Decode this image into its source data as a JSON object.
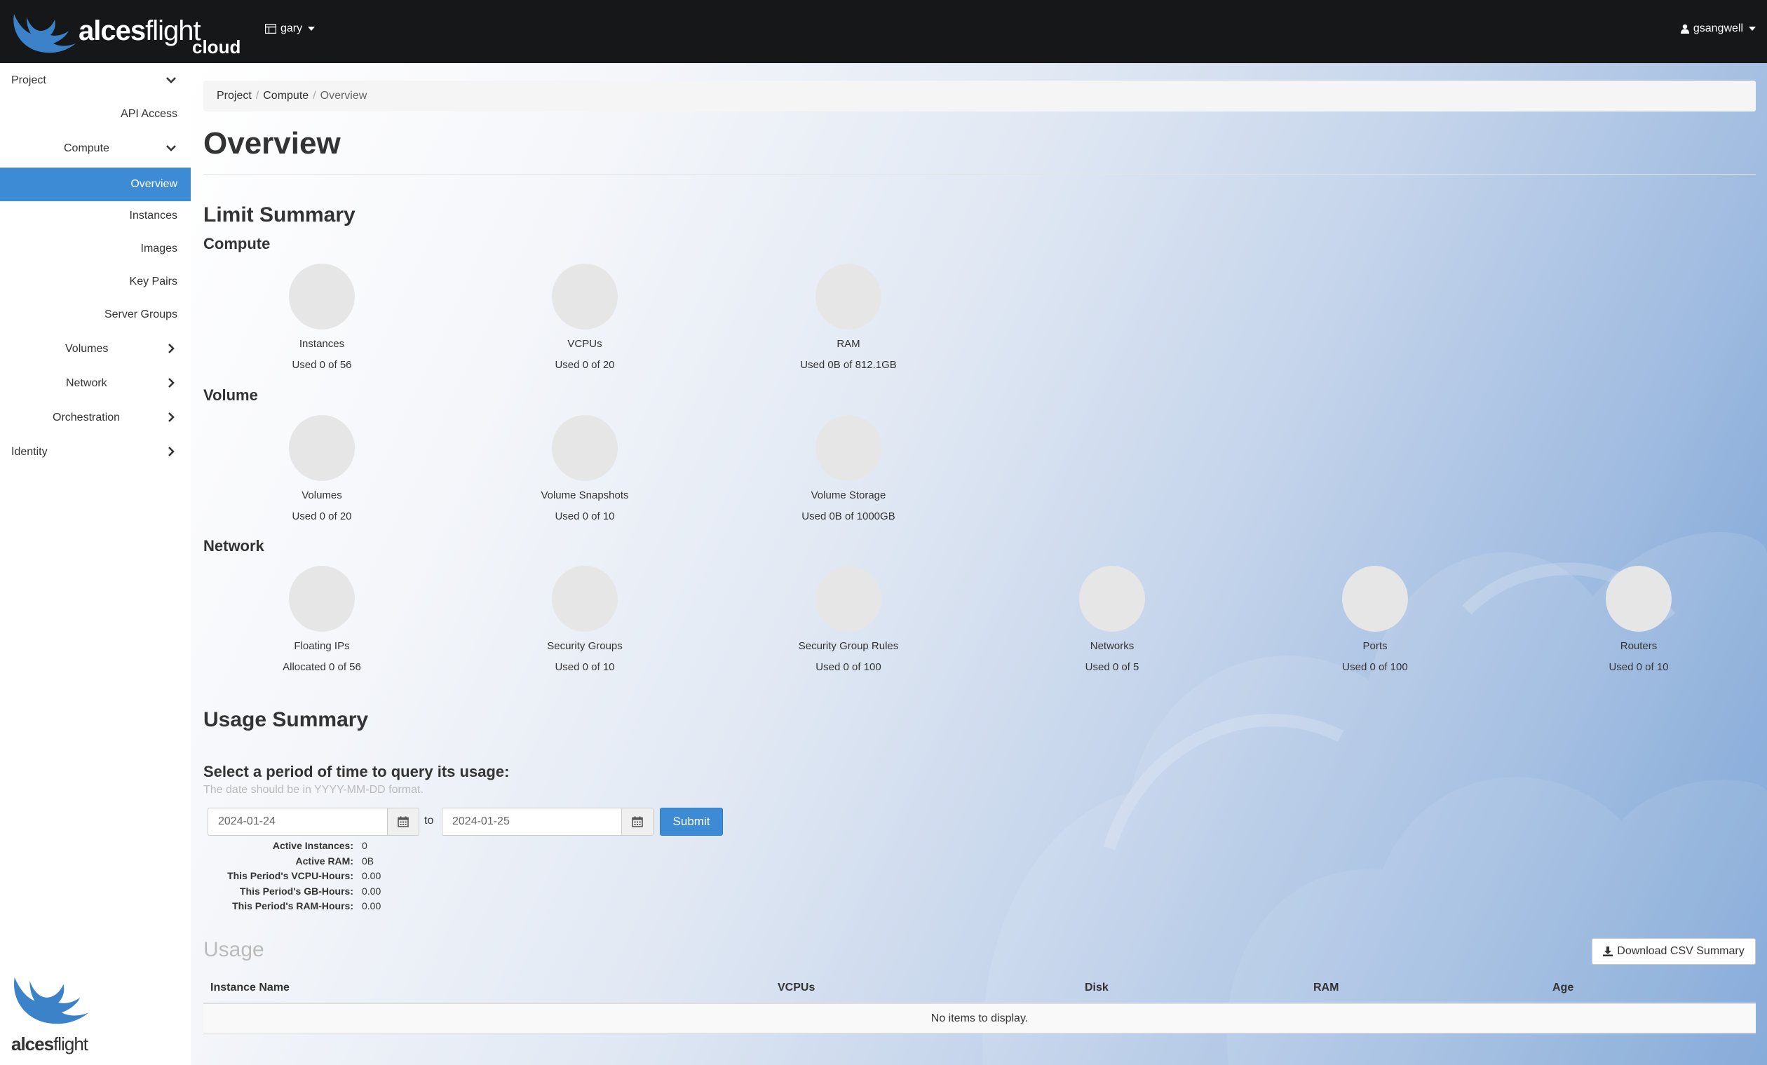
{
  "navbar": {
    "brand_bold": "alces",
    "brand_light": "flight",
    "brand_sub": "cloud",
    "project_name": "gary",
    "user_name": "gsangwell"
  },
  "sidebar": {
    "items": [
      {
        "label": "Project"
      },
      {
        "label": "API Access"
      },
      {
        "label": "Compute"
      },
      {
        "label": "Overview"
      },
      {
        "label": "Instances"
      },
      {
        "label": "Images"
      },
      {
        "label": "Key Pairs"
      },
      {
        "label": "Server Groups"
      },
      {
        "label": "Volumes"
      },
      {
        "label": "Network"
      },
      {
        "label": "Orchestration"
      },
      {
        "label": "Identity"
      }
    ],
    "logo_bold": "alces",
    "logo_light": "flight"
  },
  "breadcrumb": {
    "items": [
      "Project",
      "Compute",
      "Overview"
    ],
    "separator": "/"
  },
  "page_title": "Overview",
  "limit_summary": {
    "title": "Limit Summary",
    "compute": {
      "title": "Compute",
      "items": [
        {
          "name": "Instances",
          "used": "Used 0 of 56"
        },
        {
          "name": "VCPUs",
          "used": "Used 0 of 20"
        },
        {
          "name": "RAM",
          "used": "Used 0B of 812.1GB"
        }
      ]
    },
    "volume": {
      "title": "Volume",
      "items": [
        {
          "name": "Volumes",
          "used": "Used 0 of 20"
        },
        {
          "name": "Volume Snapshots",
          "used": "Used 0 of 10"
        },
        {
          "name": "Volume Storage",
          "used": "Used 0B of 1000GB"
        }
      ]
    },
    "network": {
      "title": "Network",
      "items": [
        {
          "name": "Floating IPs",
          "used": "Allocated 0 of 56"
        },
        {
          "name": "Security Groups",
          "used": "Used 0 of 10"
        },
        {
          "name": "Security Group Rules",
          "used": "Used 0 of 100"
        },
        {
          "name": "Networks",
          "used": "Used 0 of 5"
        },
        {
          "name": "Ports",
          "used": "Used 0 of 100"
        },
        {
          "name": "Routers",
          "used": "Used 0 of 10"
        }
      ]
    }
  },
  "usage_summary": {
    "title": "Usage Summary",
    "period_title": "Select a period of time to query its usage:",
    "hint": "The date should be in YYYY-MM-DD format.",
    "start_date": "2024-01-24",
    "to_label": "to",
    "end_date": "2024-01-25",
    "submit_label": "Submit",
    "stats": [
      {
        "label": "Active Instances:",
        "value": "0"
      },
      {
        "label": "Active RAM:",
        "value": "0B"
      },
      {
        "label": "This Period's VCPU-Hours:",
        "value": "0.00"
      },
      {
        "label": "This Period's GB-Hours:",
        "value": "0.00"
      },
      {
        "label": "This Period's RAM-Hours:",
        "value": "0.00"
      }
    ]
  },
  "usage": {
    "title": "Usage",
    "csv_label": "Download CSV Summary",
    "columns": [
      "Instance Name",
      "VCPUs",
      "Disk",
      "RAM",
      "Age"
    ],
    "empty_text": "No items to display."
  },
  "colors": {
    "navbar": "#161719",
    "accent": "#3d8bd4",
    "logo_blue": "#3b82c8"
  }
}
